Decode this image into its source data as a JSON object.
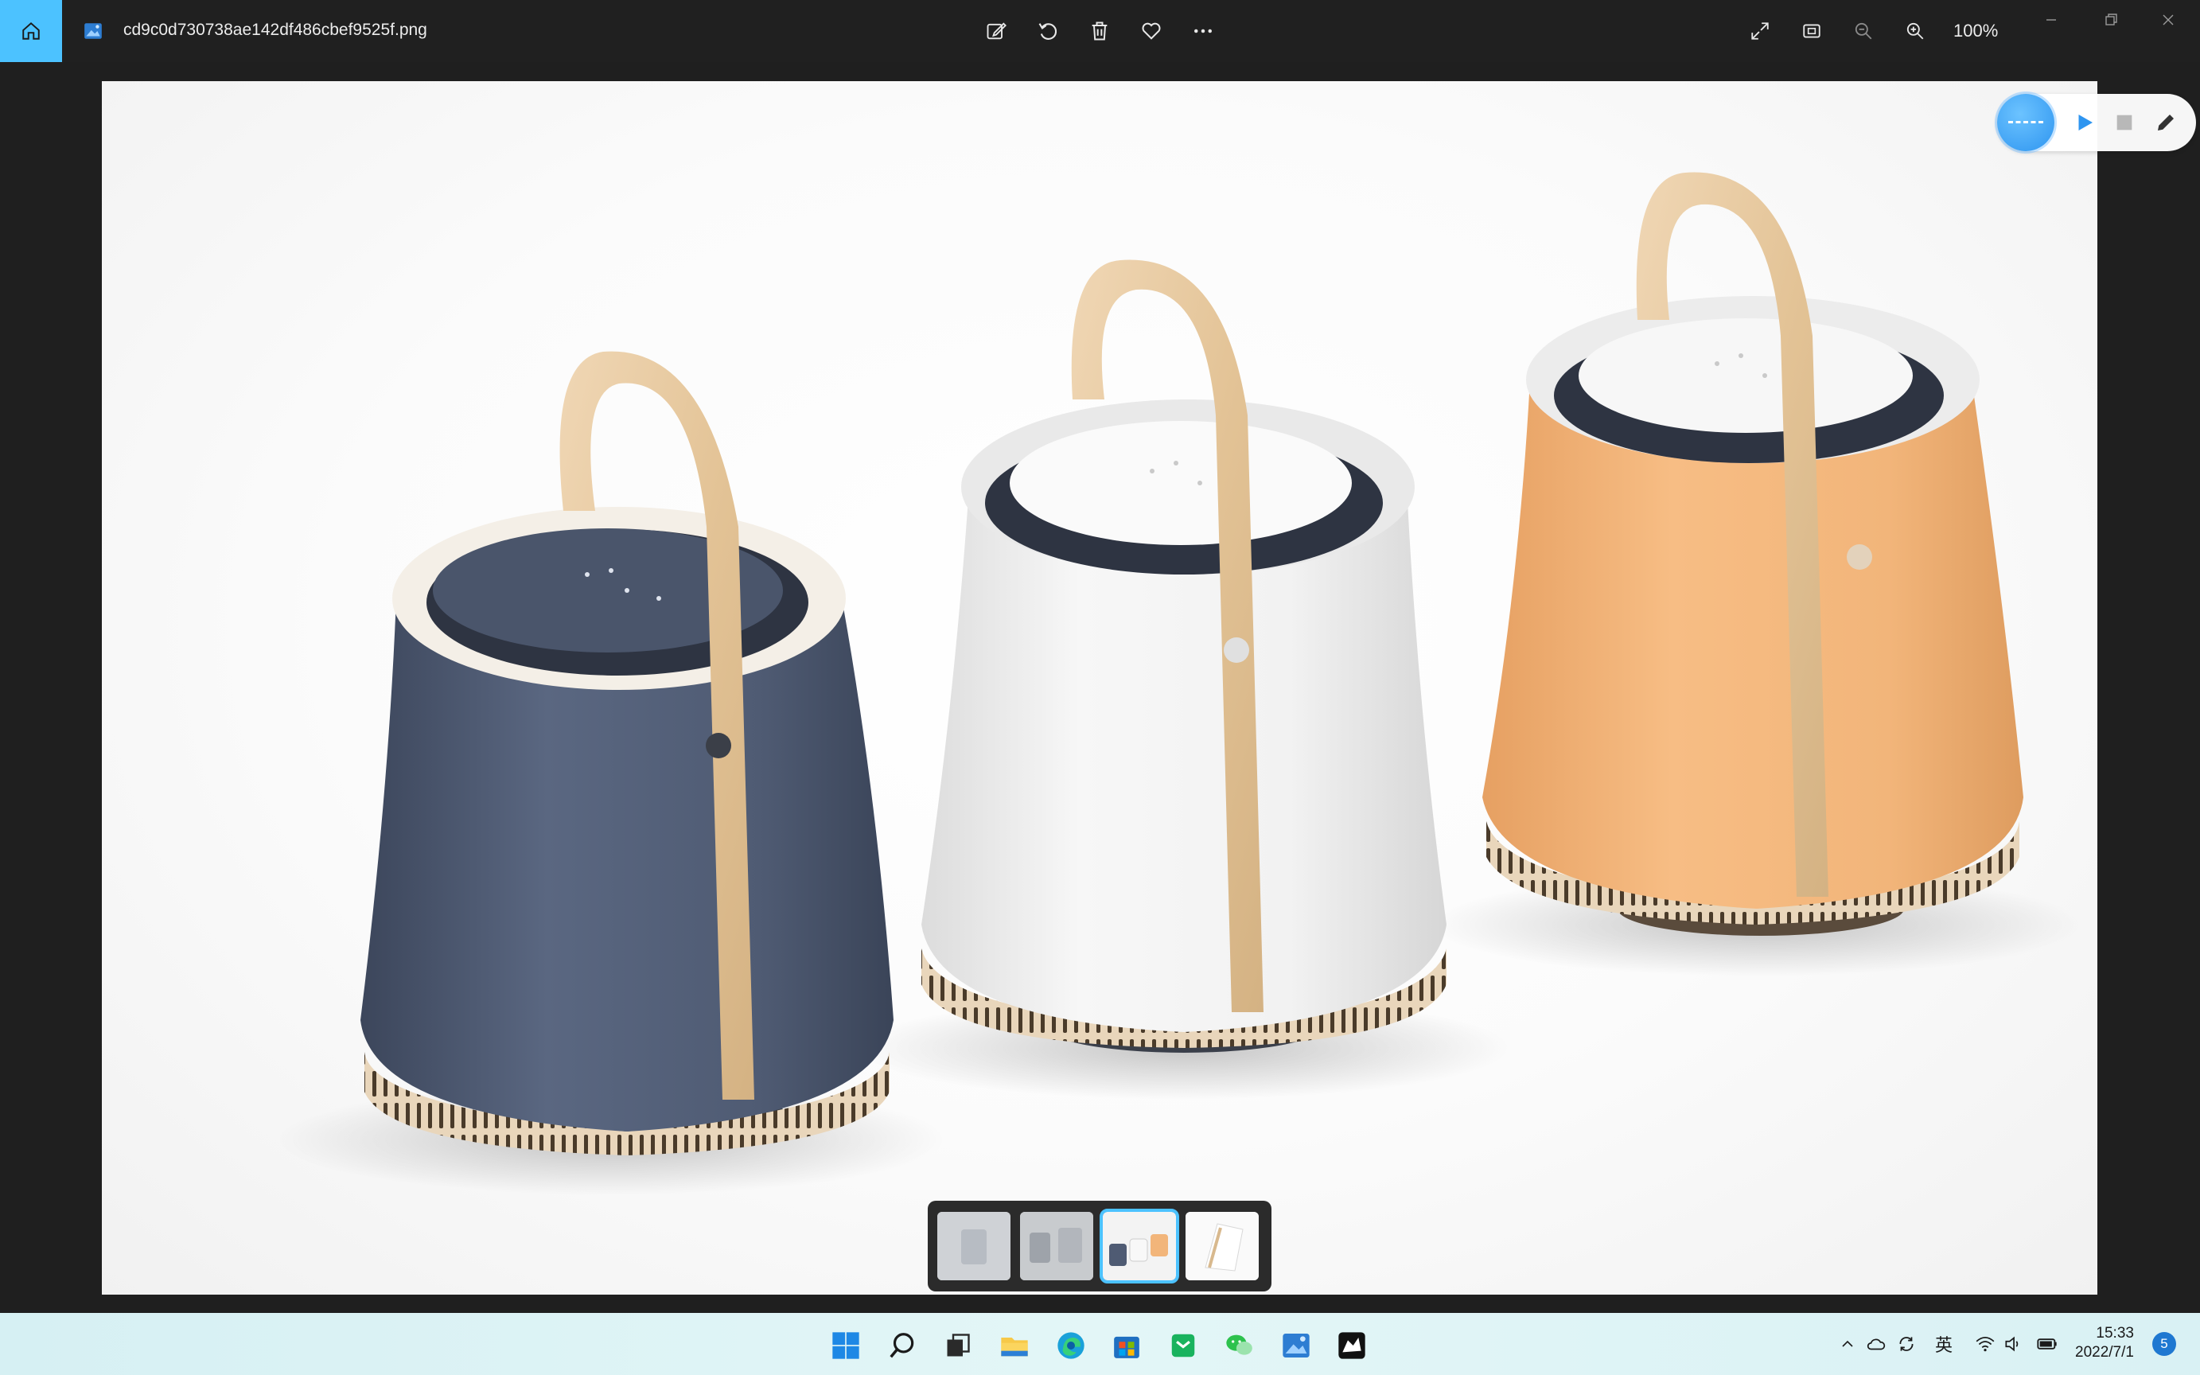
{
  "titlebar": {
    "file_name": "cd9c0d730738ae142df486cbef9525f.png",
    "zoom_level": "100%",
    "icons": [
      "home-icon",
      "edit-image-icon",
      "rotate-icon",
      "delete-icon",
      "favorite-icon",
      "more-icon",
      "fullscreen-icon",
      "fit-icon",
      "zoom-out-icon",
      "zoom-in-icon"
    ]
  },
  "overlay_tools": {
    "icons": [
      "record-icon",
      "play-icon",
      "stop-icon",
      "pen-icon"
    ]
  },
  "photo": {
    "subject": "three portable air purifiers with wooden handles",
    "colors": {
      "navy": "#4f5b73",
      "white": "#f4f4f4",
      "orange": "#f2b57a",
      "wood": "#e6c9a2"
    }
  },
  "filmstrip": {
    "thumbnails": 4,
    "active_index": 2
  },
  "taskbar": {
    "apps": [
      "start-icon",
      "search-icon",
      "task-view-icon",
      "file-explorer-icon",
      "edge-icon",
      "store-icon",
      "green-app-icon",
      "wechat-icon",
      "photos-icon",
      "rhino-icon"
    ],
    "tray": {
      "ime_label": "英",
      "time": "15:33",
      "date": "2022/7/1",
      "badge": "5"
    }
  },
  "colors": {
    "accent": "#4cc2ff",
    "titlebar": "#202020"
  }
}
